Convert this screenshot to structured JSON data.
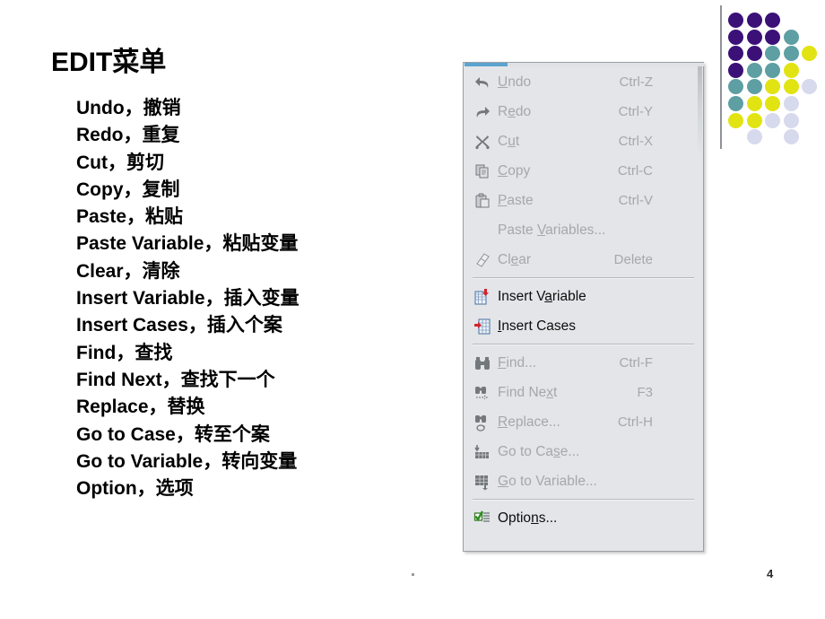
{
  "slide": {
    "title": "EDIT菜单",
    "page_number": "4",
    "footer_marker": "."
  },
  "bullets": [
    "Undo，撤销",
    "Redo，重复",
    "Cut，剪切",
    "Copy，复制",
    "Paste，粘贴",
    "Paste Variable，粘贴变量",
    "Clear，清除",
    "Insert Variable，插入变量",
    "Insert Cases，插入个案",
    "Find，查找",
    "Find Next，查找下一个",
    "Replace，替换",
    "Go to Case，转至个案",
    "Go to Variable，转向变量",
    "Option，选项"
  ],
  "menu": {
    "name": "edit-menu",
    "accent_color": "#5ba3d0",
    "background_color": "#e3e5e8",
    "disabled_text_color": "#a4a8ad",
    "enabled_text_color": "#0d0d0d",
    "groups": [
      {
        "items": [
          {
            "label_pre": "",
            "mnemonic": "U",
            "label_post": "ndo",
            "accel": "Ctrl-Z",
            "icon": "undo-arrow-icon",
            "enabled": false
          },
          {
            "label_pre": "R",
            "mnemonic": "e",
            "label_post": "do",
            "accel": "Ctrl-Y",
            "icon": "redo-arrow-icon",
            "enabled": false
          },
          {
            "label_pre": "C",
            "mnemonic": "u",
            "label_post": "t",
            "accel": "Ctrl-X",
            "icon": "scissors-icon",
            "enabled": false
          },
          {
            "label_pre": "",
            "mnemonic": "C",
            "label_post": "opy",
            "accel": "Ctrl-C",
            "icon": "copy-icon",
            "enabled": false
          },
          {
            "label_pre": "",
            "mnemonic": "P",
            "label_post": "aste",
            "accel": "Ctrl-V",
            "icon": "paste-icon",
            "enabled": false
          },
          {
            "label_pre": "Paste ",
            "mnemonic": "V",
            "label_post": "ariables...",
            "accel": "",
            "icon": "none",
            "enabled": false
          },
          {
            "label_pre": "Cl",
            "mnemonic": "e",
            "label_post": "ar",
            "accel": "Delete",
            "icon": "eraser-icon",
            "enabled": false
          }
        ]
      },
      {
        "items": [
          {
            "label_pre": "Insert V",
            "mnemonic": "a",
            "label_post": "riable",
            "accel": "",
            "icon": "insert-variable-icon",
            "enabled": true
          },
          {
            "label_pre": "",
            "mnemonic": "I",
            "label_post": "nsert Cases",
            "accel": "",
            "icon": "insert-cases-icon",
            "enabled": true
          }
        ]
      },
      {
        "items": [
          {
            "label_pre": "",
            "mnemonic": "F",
            "label_post": "ind...",
            "accel": "Ctrl-F",
            "icon": "binoculars-icon",
            "enabled": false
          },
          {
            "label_pre": "Find Ne",
            "mnemonic": "x",
            "label_post": "t",
            "accel": "F3",
            "icon": "find-next-icon",
            "enabled": false
          },
          {
            "label_pre": "",
            "mnemonic": "R",
            "label_post": "eplace...",
            "accel": "Ctrl-H",
            "icon": "replace-icon",
            "enabled": false
          },
          {
            "label_pre": "Go to Ca",
            "mnemonic": "s",
            "label_post": "e...",
            "accel": "",
            "icon": "go-to-case-icon",
            "enabled": false
          },
          {
            "label_pre": "",
            "mnemonic": "G",
            "label_post": "o to Variable...",
            "accel": "",
            "icon": "go-to-variable-icon",
            "enabled": false
          }
        ]
      },
      {
        "items": [
          {
            "label_pre": "Optio",
            "mnemonic": "n",
            "label_post": "s...",
            "accel": "",
            "icon": "options-checklist-icon",
            "enabled": true
          }
        ]
      }
    ]
  },
  "decor": {
    "colors": {
      "purple": "#3b1178",
      "teal": "#5e9fa3",
      "yellow": "#e2e312",
      "lavender": "#d7d9ed"
    },
    "dots": [
      {
        "r": 0,
        "c": 0,
        "color": "purple"
      },
      {
        "r": 0,
        "c": 1,
        "color": "purple"
      },
      {
        "r": 0,
        "c": 2,
        "color": "purple"
      },
      {
        "r": 1,
        "c": 0,
        "color": "purple"
      },
      {
        "r": 1,
        "c": 1,
        "color": "purple"
      },
      {
        "r": 1,
        "c": 2,
        "color": "purple"
      },
      {
        "r": 1,
        "c": 3,
        "color": "teal"
      },
      {
        "r": 2,
        "c": 0,
        "color": "purple"
      },
      {
        "r": 2,
        "c": 1,
        "color": "purple"
      },
      {
        "r": 2,
        "c": 2,
        "color": "teal"
      },
      {
        "r": 2,
        "c": 3,
        "color": "teal"
      },
      {
        "r": 2,
        "c": 4,
        "color": "yellow"
      },
      {
        "r": 3,
        "c": 0,
        "color": "purple"
      },
      {
        "r": 3,
        "c": 1,
        "color": "teal"
      },
      {
        "r": 3,
        "c": 2,
        "color": "teal"
      },
      {
        "r": 3,
        "c": 3,
        "color": "yellow"
      },
      {
        "r": 4,
        "c": 0,
        "color": "teal"
      },
      {
        "r": 4,
        "c": 1,
        "color": "teal"
      },
      {
        "r": 4,
        "c": 2,
        "color": "yellow"
      },
      {
        "r": 4,
        "c": 3,
        "color": "yellow"
      },
      {
        "r": 4,
        "c": 4,
        "color": "lavender"
      },
      {
        "r": 5,
        "c": 0,
        "color": "teal"
      },
      {
        "r": 5,
        "c": 1,
        "color": "yellow"
      },
      {
        "r": 5,
        "c": 2,
        "color": "yellow"
      },
      {
        "r": 5,
        "c": 3,
        "color": "lavender"
      },
      {
        "r": 6,
        "c": 0,
        "color": "yellow"
      },
      {
        "r": 6,
        "c": 1,
        "color": "yellow"
      },
      {
        "r": 6,
        "c": 2,
        "color": "lavender"
      },
      {
        "r": 6,
        "c": 3,
        "color": "lavender"
      },
      {
        "r": 7,
        "c": 1,
        "color": "lavender"
      },
      {
        "r": 7,
        "c": 3,
        "color": "lavender"
      }
    ]
  }
}
